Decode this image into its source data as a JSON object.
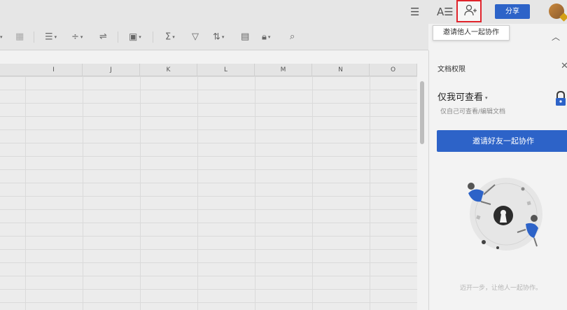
{
  "topbar": {
    "share_label": "分享",
    "font_icon_text": "A☰"
  },
  "tooltip": {
    "text": "邀请他人一起协作"
  },
  "toolbar": {
    "items": [
      "align-icon",
      "distribute-icon",
      "wrap-icon",
      "border-icon",
      "sum-icon",
      "filter-icon",
      "sort-icon",
      "freeze-icon",
      "lock-icon",
      "search-icon"
    ]
  },
  "grid": {
    "columns": [
      "I",
      "J",
      "K",
      "L",
      "M",
      "N",
      "O"
    ]
  },
  "panel": {
    "title": "文档权限",
    "permission_label": "仅我可查看",
    "permission_desc": "仅自己可查看/编辑文档",
    "invite_button": "邀请好友一起协作",
    "footer_text": "迈开一步，让他人一起协作。"
  },
  "colors": {
    "accent": "#2d63c8",
    "highlight": "#e0242c"
  }
}
